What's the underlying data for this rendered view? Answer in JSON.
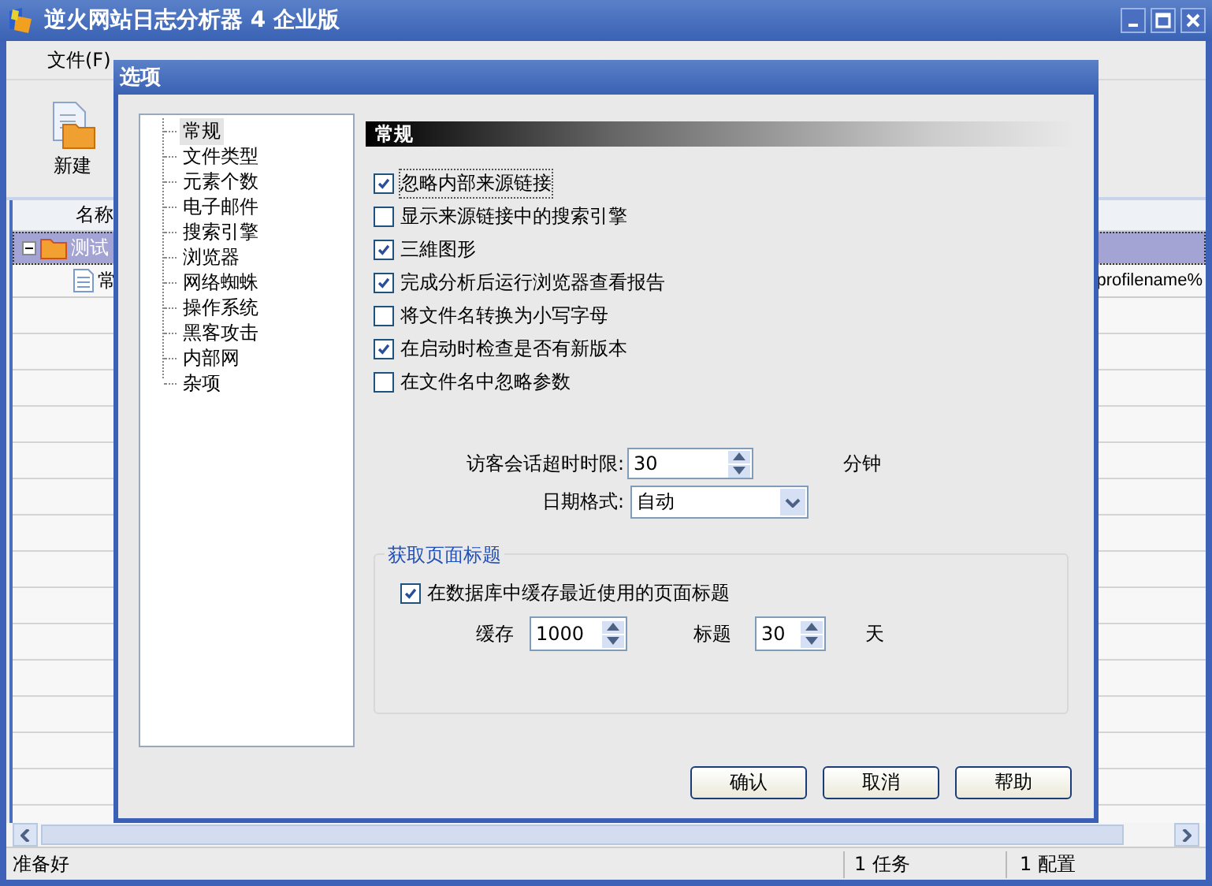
{
  "window": {
    "title": "逆火网站日志分析器 4 企业版"
  },
  "menu": [
    {
      "label": "文件(F)"
    }
  ],
  "toolbar": [
    {
      "label": "新建"
    }
  ],
  "list": {
    "columns": [
      "名称"
    ],
    "rows": [
      {
        "name": "测试",
        "selected": true,
        "expanded": true,
        "children": [
          {
            "name": "常",
            "column_2": "profilename%"
          }
        ]
      }
    ]
  },
  "status_bar": [
    "准备好",
    "1 任务",
    "1 配置"
  ],
  "dialog": {
    "title": "选项",
    "categories": [
      {
        "label": "常规",
        "selected": true
      },
      {
        "label": "文件类型",
        "selected": false
      },
      {
        "label": "元素个数",
        "selected": false
      },
      {
        "label": "电子邮件",
        "selected": false
      },
      {
        "label": "搜索引擎",
        "selected": false
      },
      {
        "label": "浏览器",
        "selected": false
      },
      {
        "label": "网络蜘蛛",
        "selected": false
      },
      {
        "label": "操作系统",
        "selected": false
      },
      {
        "label": "黑客攻击",
        "selected": false
      },
      {
        "label": "内部网",
        "selected": false
      },
      {
        "label": "杂项",
        "selected": false
      }
    ],
    "section_title": "常规",
    "options": [
      {
        "label": "忽略内部来源链接",
        "checked": true,
        "focused": true
      },
      {
        "label": "显示来源链接中的搜索引擎",
        "checked": false,
        "focused": false
      },
      {
        "label": "三維图形",
        "checked": true,
        "focused": false
      },
      {
        "label": "完成分析后运行浏览器查看报告",
        "checked": true,
        "focused": false
      },
      {
        "label": "将文件名转换为小写字母",
        "checked": false,
        "focused": false
      },
      {
        "label": "在启动时检查是否有新版本",
        "checked": true,
        "focused": false
      },
      {
        "label": "在文件名中忽略参数",
        "checked": false,
        "focused": false
      }
    ],
    "fields": [
      {
        "kind": "spin",
        "label": "访客会话超时时限:",
        "value": "30",
        "unit": "分钟"
      },
      {
        "kind": "dropdown",
        "label": "日期格式:",
        "value": "自动"
      }
    ],
    "group": {
      "title": "获取页面标题",
      "option": {
        "label": "在数据库中缓存最近使用的页面标题",
        "checked": true
      },
      "fields": [
        {
          "label": "缓存",
          "value": "1000"
        },
        {
          "label": "标题",
          "value": "30",
          "unit": "天"
        }
      ]
    },
    "buttons": [
      "确认",
      "取消",
      "帮助"
    ]
  }
}
